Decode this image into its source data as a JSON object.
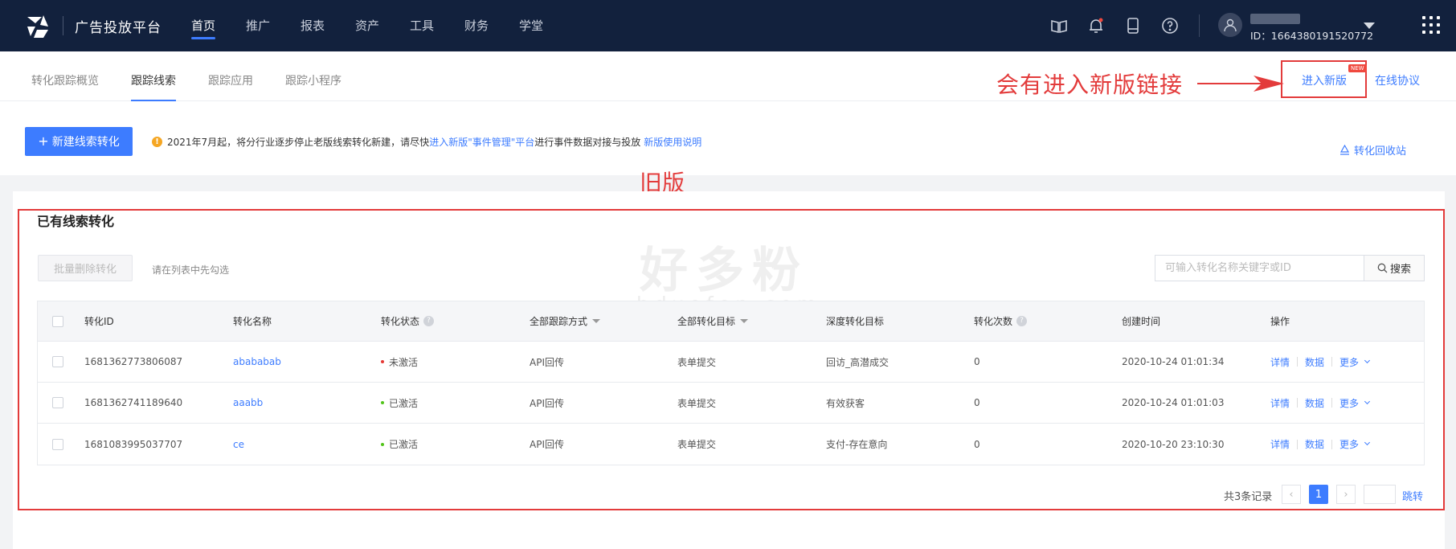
{
  "header": {
    "brand": "广告投放平台",
    "nav": [
      {
        "label": "首页",
        "active": true
      },
      {
        "label": "推广"
      },
      {
        "label": "报表"
      },
      {
        "label": "资产"
      },
      {
        "label": "工具"
      },
      {
        "label": "财务"
      },
      {
        "label": "学堂"
      }
    ],
    "icons": [
      "book-icon",
      "bell-icon",
      "mobile-icon",
      "help-icon"
    ],
    "user_id": "ID：1664380191520772"
  },
  "subnav": {
    "tabs": [
      {
        "label": "转化跟踪概览"
      },
      {
        "label": "跟踪线索",
        "active": true
      },
      {
        "label": "跟踪应用"
      },
      {
        "label": "跟踪小程序"
      }
    ],
    "annotation": "会有进入新版链接",
    "new_version_link": "进入新版",
    "new_badge": "NEW",
    "protocol_link": "在线协议"
  },
  "toolbar": {
    "new_button": "新建线索转化",
    "notice_prefix": "2021年7月起，将分行业逐步停止老版线索转化新建，请尽快",
    "notice_link1": "进入新版\"事件管理\"平台",
    "notice_middle": "进行事件数据对接与投放",
    "notice_link2": "新版使用说明",
    "recycle": "转化回收站"
  },
  "old_label": "旧版",
  "watermark": {
    "cn": "好多粉",
    "en": "hduofen.com"
  },
  "list": {
    "title": "已有线索转化",
    "batch_delete": "批量删除转化",
    "batch_hint": "请在列表中先勾选",
    "search_placeholder": "可输入转化名称关键字或ID",
    "search_button": "搜索",
    "columns": {
      "id": "转化ID",
      "name": "转化名称",
      "status": "转化状态",
      "method": "全部跟踪方式",
      "goal": "全部转化目标",
      "deep": "深度转化目标",
      "count": "转化次数",
      "created": "创建时间",
      "ops": "操作"
    },
    "rows": [
      {
        "id": "1681362773806087",
        "name": "abababab",
        "status": "未激活",
        "status_color": "#e53935",
        "method": "API回传",
        "goal": "表单提交",
        "deep": "回访_高潜成交",
        "count": "0",
        "created": "2020-10-24 01:01:34"
      },
      {
        "id": "1681362741189640",
        "name": "aaabb",
        "status": "已激活",
        "status_color": "#52c41a",
        "method": "API回传",
        "goal": "表单提交",
        "deep": "有效获客",
        "count": "0",
        "created": "2020-10-24 01:01:03"
      },
      {
        "id": "1681083995037707",
        "name": "ce",
        "status": "已激活",
        "status_color": "#52c41a",
        "method": "API回传",
        "goal": "表单提交",
        "deep": "支付-存在意向",
        "count": "0",
        "created": "2020-10-20 23:10:30"
      }
    ],
    "ops": {
      "detail": "详情",
      "data": "数据",
      "more": "更多"
    }
  },
  "pagination": {
    "total": "共3条记录",
    "current": "1",
    "jump": "跳转"
  },
  "colors": {
    "primary": "#3d7cff",
    "nav_bg": "#12213d",
    "annotation": "#e33b3b"
  }
}
